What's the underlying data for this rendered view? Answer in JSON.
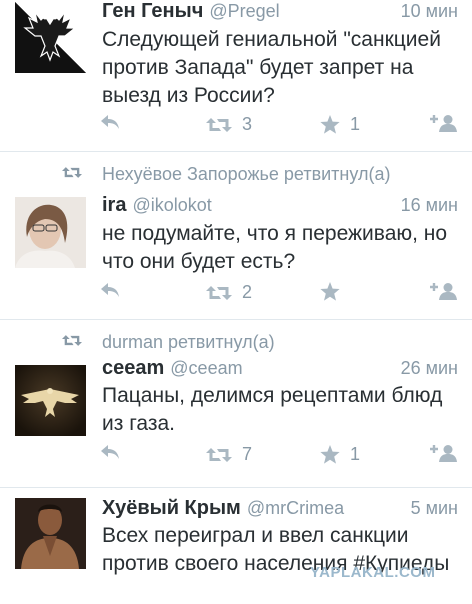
{
  "tweets": [
    {
      "name": "Ген Геныч",
      "handle": "@Pregel",
      "time": "10 мин",
      "text": "Следующей гениальной \"санкцией против Запада\" будет запрет на выезд из России?",
      "retweets": "3",
      "favorites": "1",
      "avatar_icon": "double-headed-eagle-icon"
    },
    {
      "retweeted_by": "Нехуёвое Запорожье ретвитнул(а)",
      "name": "ira",
      "handle": "@ikolokot",
      "time": "16 мин",
      "text": "не подумайте, что я переживаю, но что они будет есть?",
      "retweets": "2",
      "favorites": "",
      "avatar_icon": "user-photo-icon"
    },
    {
      "retweeted_by": "durman ретвитнул(а)",
      "name": "ceeam",
      "handle": "@ceeam",
      "time": "26 мин",
      "text": "Пацаны, делимся рецептами блюд из газа.",
      "retweets": "7",
      "favorites": "1",
      "avatar_icon": "golden-eagle-icon"
    },
    {
      "name": "Хуёвый Крым",
      "handle": "@mrCrimea",
      "time": "5 мин",
      "text": "Всех переиграл и ввел санкции против своего населения #Купиеды",
      "avatar_icon": "man-photo-icon"
    }
  ],
  "watermark": "YAPLAKAL.COM",
  "colors": {
    "muted": "#8899a6",
    "icon": "#aab8c2",
    "text": "#292f33",
    "divider": "#e1e8ed"
  }
}
